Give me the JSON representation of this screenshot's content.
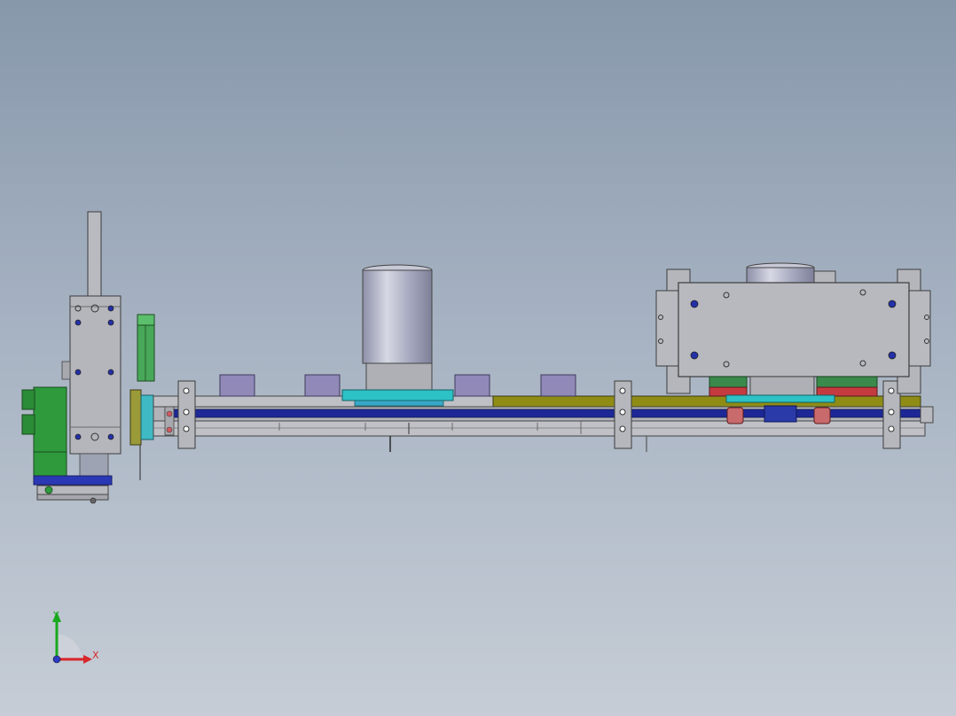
{
  "triad": {
    "y_label": "Y",
    "x_label": "X",
    "y_color": "#19a81f",
    "x_color": "#d8262a",
    "z_color": "#2d3ac4"
  },
  "colors": {
    "viewport_top": "#8798ab",
    "viewport_bottom": "#c6cdd6",
    "steel": "#b5b7bd",
    "rail_blue": "#1d2896",
    "olive_strip": "#8f8c16",
    "cyan_part": "#2cc2c6",
    "violet_block": "#9189b8",
    "green_part": "#2e9a3c",
    "red_part": "#c43b3f"
  }
}
